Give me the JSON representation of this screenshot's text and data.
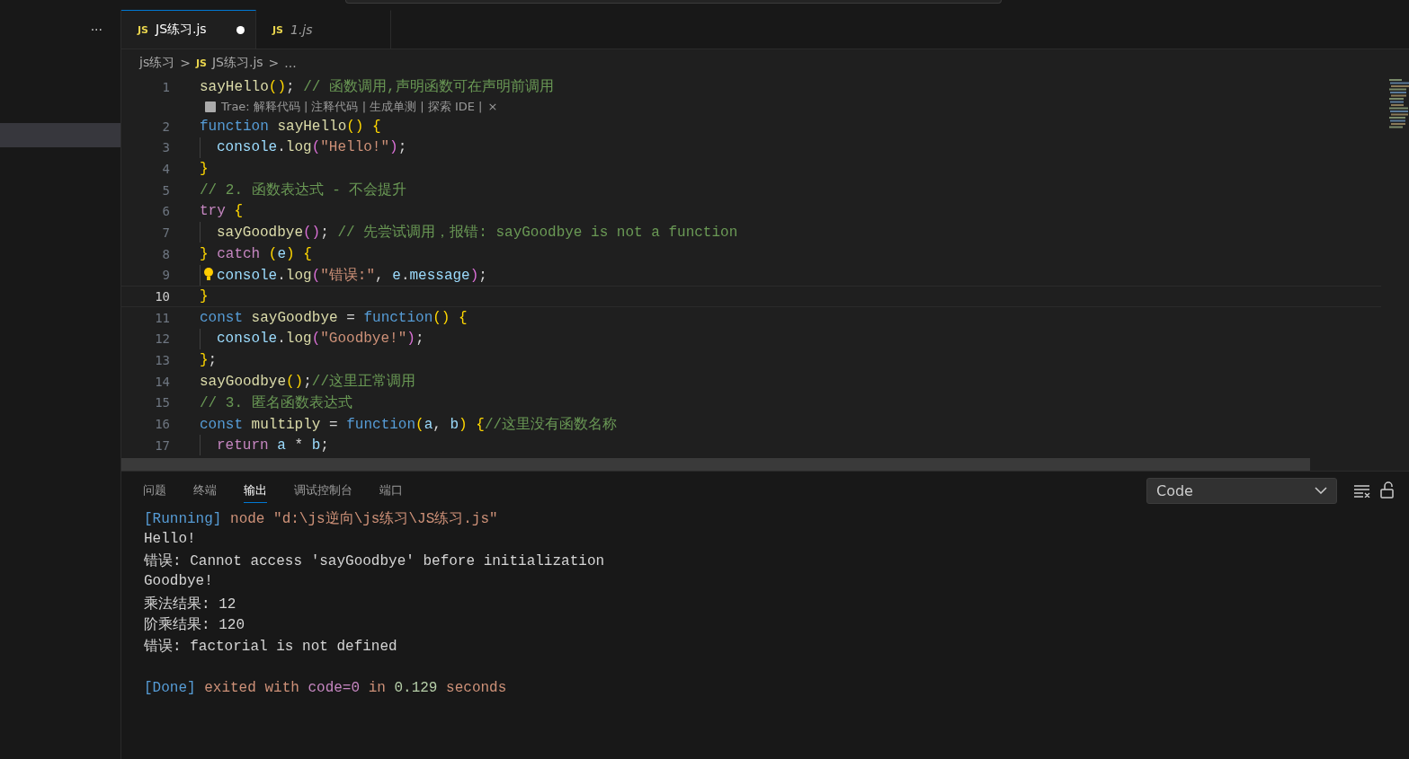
{
  "sidebar": {
    "more": "···",
    "items": [
      {
        "selected": true
      }
    ]
  },
  "tabs": [
    {
      "label": "JS练习.js",
      "icon": "JS",
      "selected": true,
      "dirty": true,
      "italic": false
    },
    {
      "label": "1.js",
      "icon": "JS",
      "selected": false,
      "dirty": false,
      "italic": true
    }
  ],
  "breadcrumb": {
    "folder": "js练习",
    "sep1": ">",
    "icon": "JS",
    "file": "JS练习.js",
    "sep2": ">",
    "rest": "..."
  },
  "code": {
    "lines": [
      {
        "number": "1",
        "current": false,
        "lightbulb": false,
        "indent": false,
        "tokens": [
          {
            "kind": "fn",
            "text": "sayHello"
          },
          {
            "kind": "paren",
            "text": "()"
          },
          {
            "kind": "plain",
            "text": "; "
          },
          {
            "kind": "cmt",
            "text": "// 函数调用,声明函数可在声明前调用"
          }
        ],
        "codelens": {
          "text": "Trae: 解释代码 | 注释代码 | 生成单测 | 探索 IDE | ",
          "close": "×"
        }
      },
      {
        "number": "2",
        "current": false,
        "lightbulb": false,
        "indent": false,
        "tokens": [
          {
            "kind": "kw",
            "text": "function "
          },
          {
            "kind": "fn",
            "text": "sayHello"
          },
          {
            "kind": "paren",
            "text": "() {"
          }
        ]
      },
      {
        "number": "3",
        "current": false,
        "lightbulb": false,
        "indent": true,
        "tokens": [
          {
            "kind": "var",
            "text": "console"
          },
          {
            "kind": "plain",
            "text": "."
          },
          {
            "kind": "fn",
            "text": "log"
          },
          {
            "kind": "paren2",
            "text": "("
          },
          {
            "kind": "str",
            "text": "\"Hello!\""
          },
          {
            "kind": "paren2",
            "text": ")"
          },
          {
            "kind": "plain",
            "text": ";"
          }
        ]
      },
      {
        "number": "4",
        "current": false,
        "lightbulb": false,
        "indent": false,
        "tokens": [
          {
            "kind": "paren",
            "text": "}"
          }
        ]
      },
      {
        "number": "5",
        "current": false,
        "lightbulb": false,
        "indent": false,
        "tokens": [
          {
            "kind": "cmt",
            "text": "// 2. 函数表达式 - 不会提升"
          }
        ]
      },
      {
        "number": "6",
        "current": false,
        "lightbulb": false,
        "indent": false,
        "tokens": [
          {
            "kind": "ctl",
            "text": "try "
          },
          {
            "kind": "paren",
            "text": "{"
          }
        ]
      },
      {
        "number": "7",
        "current": false,
        "lightbulb": false,
        "indent": true,
        "tokens": [
          {
            "kind": "fn",
            "text": "sayGoodbye"
          },
          {
            "kind": "paren2",
            "text": "()"
          },
          {
            "kind": "plain",
            "text": "; "
          },
          {
            "kind": "cmt",
            "text": "// 先尝试调用，报错: sayGoodbye is not a function"
          }
        ]
      },
      {
        "number": "8",
        "current": false,
        "lightbulb": false,
        "indent": false,
        "tokens": [
          {
            "kind": "paren",
            "text": "} "
          },
          {
            "kind": "ctl",
            "text": "catch "
          },
          {
            "kind": "paren",
            "text": "("
          },
          {
            "kind": "var",
            "text": "e"
          },
          {
            "kind": "paren",
            "text": ") {"
          }
        ]
      },
      {
        "number": "9",
        "current": false,
        "lightbulb": true,
        "indent": true,
        "tokens": [
          {
            "kind": "var",
            "text": "console"
          },
          {
            "kind": "plain",
            "text": "."
          },
          {
            "kind": "fn",
            "text": "log"
          },
          {
            "kind": "paren2",
            "text": "("
          },
          {
            "kind": "str",
            "text": "\"错误:\""
          },
          {
            "kind": "plain",
            "text": ", "
          },
          {
            "kind": "var",
            "text": "e"
          },
          {
            "kind": "plain",
            "text": "."
          },
          {
            "kind": "var",
            "text": "message"
          },
          {
            "kind": "paren2",
            "text": ")"
          },
          {
            "kind": "plain",
            "text": ";"
          }
        ]
      },
      {
        "number": "10",
        "current": true,
        "lightbulb": false,
        "indent": false,
        "tokens": [
          {
            "kind": "paren",
            "text": "}"
          }
        ]
      },
      {
        "number": "11",
        "current": false,
        "lightbulb": false,
        "indent": false,
        "tokens": [
          {
            "kind": "kw",
            "text": "const "
          },
          {
            "kind": "fn",
            "text": "sayGoodbye"
          },
          {
            "kind": "plain",
            "text": " = "
          },
          {
            "kind": "kw",
            "text": "function"
          },
          {
            "kind": "paren",
            "text": "() {"
          }
        ]
      },
      {
        "number": "12",
        "current": false,
        "lightbulb": false,
        "indent": true,
        "tokens": [
          {
            "kind": "var",
            "text": "console"
          },
          {
            "kind": "plain",
            "text": "."
          },
          {
            "kind": "fn",
            "text": "log"
          },
          {
            "kind": "paren2",
            "text": "("
          },
          {
            "kind": "str",
            "text": "\"Goodbye!\""
          },
          {
            "kind": "paren2",
            "text": ")"
          },
          {
            "kind": "plain",
            "text": ";"
          }
        ]
      },
      {
        "number": "13",
        "current": false,
        "lightbulb": false,
        "indent": false,
        "tokens": [
          {
            "kind": "paren",
            "text": "}"
          },
          {
            "kind": "plain",
            "text": ";"
          }
        ]
      },
      {
        "number": "14",
        "current": false,
        "lightbulb": false,
        "indent": false,
        "tokens": [
          {
            "kind": "fn",
            "text": "sayGoodbye"
          },
          {
            "kind": "paren",
            "text": "()"
          },
          {
            "kind": "plain",
            "text": ";"
          },
          {
            "kind": "cmt",
            "text": "//这里正常调用"
          }
        ]
      },
      {
        "number": "15",
        "current": false,
        "lightbulb": false,
        "indent": false,
        "tokens": [
          {
            "kind": "cmt",
            "text": "// 3. 匿名函数表达式"
          }
        ]
      },
      {
        "number": "16",
        "current": false,
        "lightbulb": false,
        "indent": false,
        "tokens": [
          {
            "kind": "kw",
            "text": "const "
          },
          {
            "kind": "fn",
            "text": "multiply"
          },
          {
            "kind": "plain",
            "text": " = "
          },
          {
            "kind": "kw",
            "text": "function"
          },
          {
            "kind": "paren",
            "text": "("
          },
          {
            "kind": "var",
            "text": "a"
          },
          {
            "kind": "plain",
            "text": ", "
          },
          {
            "kind": "var",
            "text": "b"
          },
          {
            "kind": "paren",
            "text": ") {"
          },
          {
            "kind": "cmt",
            "text": "//这里没有函数名称"
          }
        ]
      },
      {
        "number": "17",
        "current": false,
        "lightbulb": false,
        "indent": true,
        "tokens": [
          {
            "kind": "ctl",
            "text": "return "
          },
          {
            "kind": "var",
            "text": "a"
          },
          {
            "kind": "plain",
            "text": " * "
          },
          {
            "kind": "var",
            "text": "b"
          },
          {
            "kind": "plain",
            "text": ";"
          }
        ]
      }
    ]
  },
  "panel": {
    "tabs": [
      {
        "label": "问题",
        "selected": false
      },
      {
        "label": "终端",
        "selected": false
      },
      {
        "label": "输出",
        "selected": true
      },
      {
        "label": "调试控制台",
        "selected": false
      },
      {
        "label": "端口",
        "selected": false
      }
    ],
    "channel": "Code",
    "output": [
      {
        "tokens": [
          {
            "kind": "tag",
            "text": "[Running]"
          },
          {
            "kind": "str",
            "text": " node \"d:\\js逆向\\js练习\\JS练习.js\""
          }
        ]
      },
      {
        "tokens": [
          {
            "kind": "plain",
            "text": "Hello!"
          }
        ]
      },
      {
        "tokens": [
          {
            "kind": "plain",
            "text": "错误: Cannot access 'sayGoodbye' before initialization"
          }
        ]
      },
      {
        "tokens": [
          {
            "kind": "plain",
            "text": "Goodbye!"
          }
        ]
      },
      {
        "tokens": [
          {
            "kind": "plain",
            "text": "乘法结果: 12"
          }
        ]
      },
      {
        "tokens": [
          {
            "kind": "plain",
            "text": "阶乘结果: 120"
          }
        ]
      },
      {
        "tokens": [
          {
            "kind": "plain",
            "text": "错误: factorial is not defined"
          }
        ]
      }
    ],
    "summary": [
      {
        "kind": "tag",
        "text": "[Done]"
      },
      {
        "kind": "str",
        "text": " exited with "
      },
      {
        "kind": "code",
        "text": "code=0"
      },
      {
        "kind": "str",
        "text": " in "
      },
      {
        "kind": "num",
        "text": "0.129"
      },
      {
        "kind": "str",
        "text": " seconds"
      }
    ]
  }
}
